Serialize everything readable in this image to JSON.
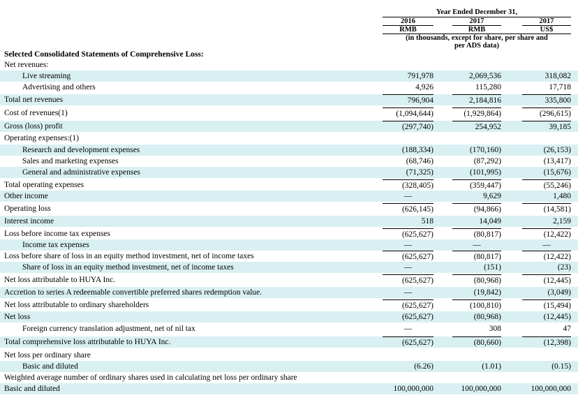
{
  "header": {
    "period": "Year Ended December 31,",
    "years": [
      "2016",
      "2017",
      "2017"
    ],
    "currencies": [
      "RMB",
      "RMB",
      "US$"
    ],
    "units_note_line1": "(in thousands, except for share, per share and",
    "units_note_line2": "per ADS data)"
  },
  "section_title": "Selected Consolidated Statements of Comprehensive Loss:",
  "rows": [
    {
      "label": "Net revenues:",
      "values": [
        "",
        "",
        ""
      ]
    },
    {
      "label": "Live streaming",
      "values": [
        "791,978",
        "2,069,536",
        "318,082"
      ]
    },
    {
      "label": "Advertising and others",
      "values": [
        "4,926",
        "115,280",
        "17,718"
      ]
    },
    {
      "label": "Total net revenues",
      "values": [
        "796,904",
        "2,184,816",
        "335,800"
      ]
    },
    {
      "label": "Cost of revenues(1)",
      "values": [
        "(1,094,644)",
        "(1,929,864)",
        "(296,615)"
      ]
    },
    {
      "label": "Gross (loss) profit",
      "values": [
        "(297,740)",
        "254,952",
        "39,185"
      ]
    },
    {
      "label": "Operating expenses:(1)",
      "values": [
        "",
        "",
        ""
      ]
    },
    {
      "label": "Research and development expenses",
      "values": [
        "(188,334)",
        "(170,160)",
        "(26,153)"
      ]
    },
    {
      "label": "Sales and marketing expenses",
      "values": [
        "(68,746)",
        "(87,292)",
        "(13,417)"
      ]
    },
    {
      "label": "General and administrative expenses",
      "values": [
        "(71,325)",
        "(101,995)",
        "(15,676)"
      ]
    },
    {
      "label": "Total operating expenses",
      "values": [
        "(328,405)",
        "(359,447)",
        "(55,246)"
      ]
    },
    {
      "label": "Other income",
      "values": [
        "—",
        "9,629",
        "1,480"
      ]
    },
    {
      "label": "Operating loss",
      "values": [
        "(626,145)",
        "(94,866)",
        "(14,581)"
      ]
    },
    {
      "label": "Interest income",
      "values": [
        "518",
        "14,049",
        "2,159"
      ]
    },
    {
      "label": "Loss before income tax expenses",
      "values": [
        "(625,627)",
        "(80,817)",
        "(12,422)"
      ]
    },
    {
      "label": "Income tax expenses",
      "values": [
        "—",
        "—",
        "—"
      ]
    },
    {
      "label": "Loss before share of loss in an equity method investment, net of income taxes",
      "values": [
        "(625,627)",
        "(80,817)",
        "(12,422)"
      ]
    },
    {
      "label": "Share of loss in an equity method investment, net of income taxes",
      "values": [
        "—",
        "(151)",
        "(23)"
      ]
    },
    {
      "label": "Net loss attributable to HUYA Inc.",
      "values": [
        "(625,627)",
        "(80,968)",
        "(12,445)"
      ]
    },
    {
      "label": "Accretion to series A redeemable convertible preferred shares redemption value.",
      "values": [
        "—",
        "(19,842)",
        "(3,049)"
      ]
    },
    {
      "label": "Net loss attributable to ordinary shareholders",
      "values": [
        "(625,627)",
        "(100,810)",
        "(15,494)"
      ]
    },
    {
      "label": "Net loss",
      "values": [
        "(625,627)",
        "(80,968)",
        "(12,445)"
      ]
    },
    {
      "label": "Foreign currency translation adjustment, net of nil tax",
      "values": [
        "—",
        "308",
        "47"
      ]
    },
    {
      "label": "Total comprehensive loss attributable to HUYA Inc.",
      "values": [
        "(625,627)",
        "(80,660)",
        "(12,398)"
      ]
    },
    {
      "label": "Net loss per ordinary share",
      "values": [
        "",
        "",
        ""
      ]
    },
    {
      "label": "Basic and diluted",
      "values": [
        "(6.26)",
        "(1.01)",
        "(0.15)"
      ]
    },
    {
      "label": "Weighted average number of ordinary shares used in calculating net loss per ordinary share",
      "values": [
        "",
        "",
        ""
      ]
    },
    {
      "label": "Basic and diluted",
      "values": [
        "100,000,000",
        "100,000,000",
        "100,000,000"
      ]
    }
  ],
  "colors": {
    "row_shade": "#d9f0f2",
    "text": "#000000",
    "background": "#ffffff"
  }
}
